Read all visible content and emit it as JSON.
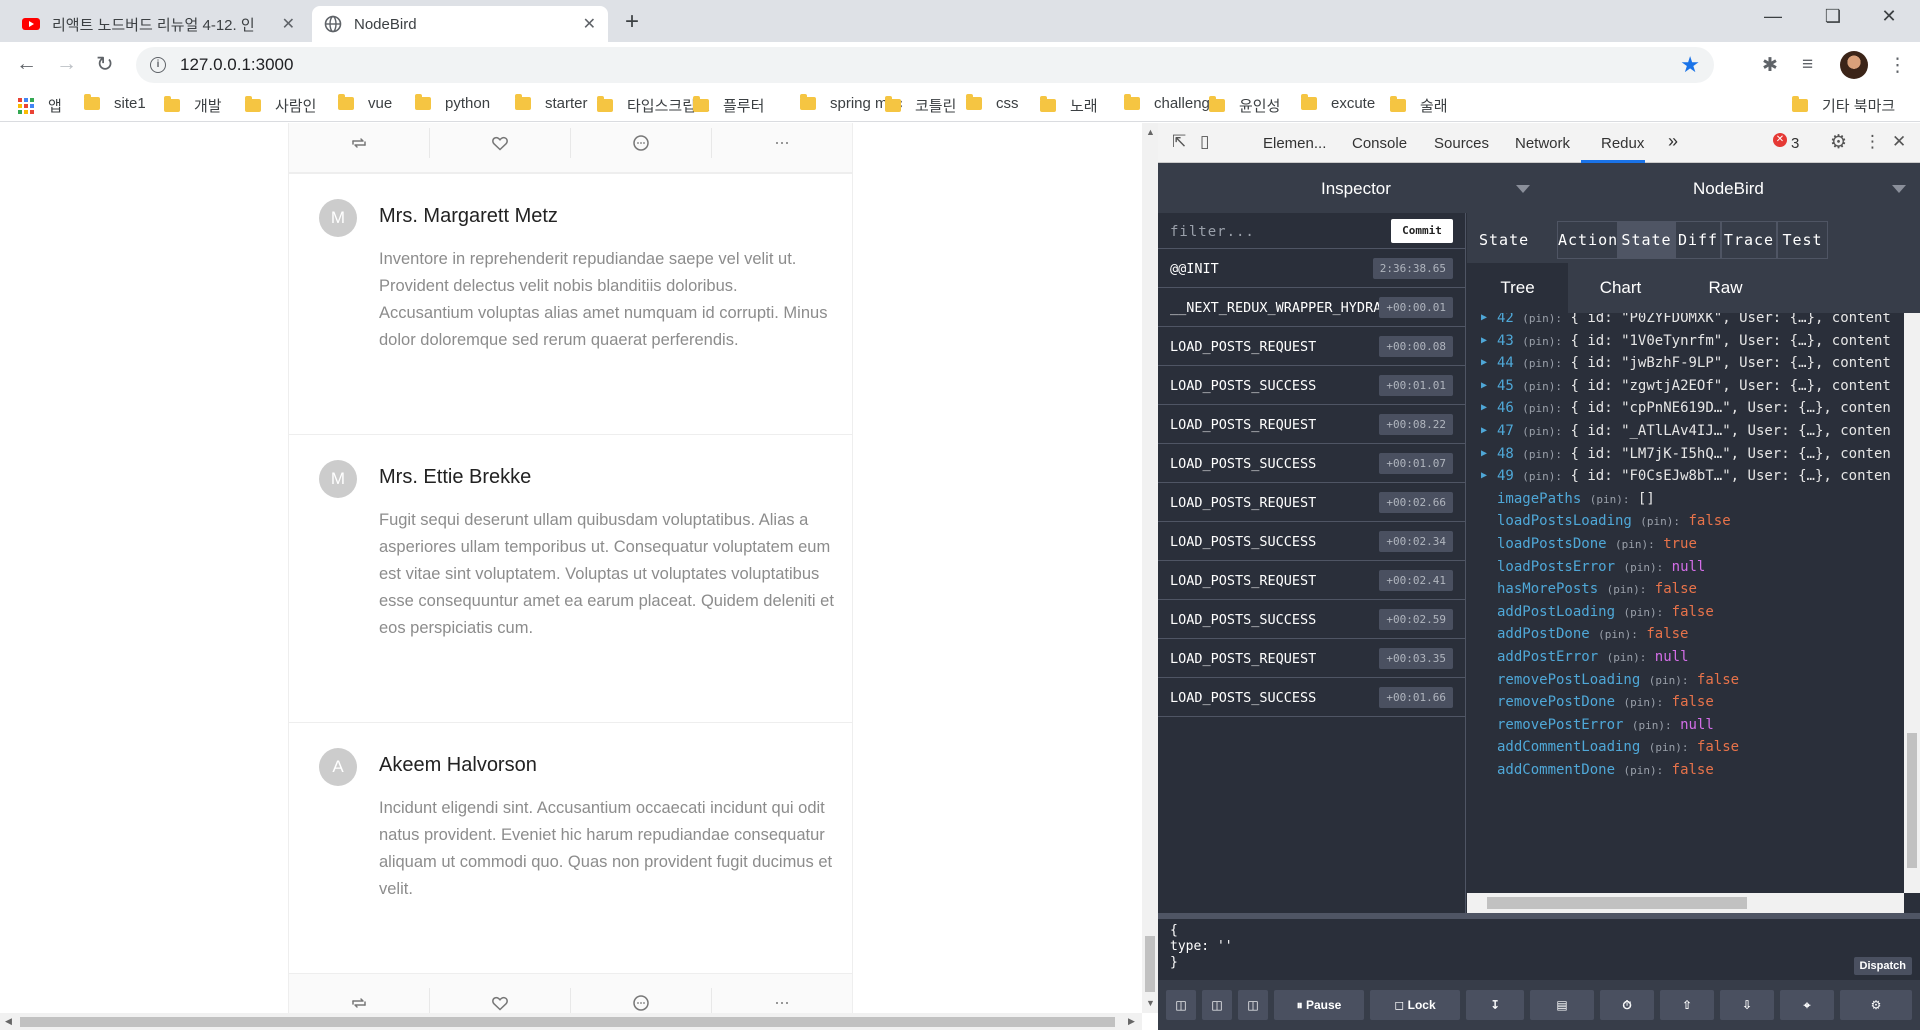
{
  "browser": {
    "tabs": [
      {
        "title": "리액트 노드버드 리뉴얼 4-12. 인",
        "close": "✕"
      },
      {
        "title": "NodeBird",
        "close": "✕"
      }
    ],
    "new_tab": "+",
    "url": "127.0.0.1:3000",
    "accent": "#1a73e8"
  },
  "bookmarks": {
    "apps": "앱",
    "items": [
      "site1",
      "개발",
      "사람인",
      "vue",
      "python",
      "starter",
      "타입스크립트",
      "플루터",
      "spring mvc",
      "코틀린",
      "css",
      "노래",
      "challenge",
      "윤인성",
      "excute",
      "술래"
    ],
    "other": "기타 북마크"
  },
  "feed": {
    "posts": [
      {
        "avatar": "M",
        "author": "Mrs. Margarett Metz",
        "content": "Inventore in reprehenderit repudiandae saepe vel velit ut. Provident delectus velit nobis blanditiis doloribus. Accusantium voluptas alias amet numquam id corrupti. Minus dolor doloremque sed rerum quaerat perferendis."
      },
      {
        "avatar": "M",
        "author": "Mrs. Ettie Brekke",
        "content": "Fugit sequi deserunt ullam quibusdam voluptatibus. Alias a asperiores ullam temporibus ut. Consequatur voluptatem eum est vitae sint voluptatem. Voluptas ut voluptates voluptatibus esse consequuntur amet ea earum placeat. Quidem deleniti et eos perspiciatis cum."
      },
      {
        "avatar": "A",
        "author": "Akeem Halvorson",
        "content": "Incidunt eligendi sint. Accusantium occaecati incidunt qui odit natus provident. Eveniet hic harum repudiandae consequatur aliquam ut commodi quo. Quas non provident fugit ducimus et velit."
      }
    ],
    "action_icons": [
      "retweet-icon",
      "heart-icon",
      "message-icon",
      "ellipsis-icon"
    ]
  },
  "devtools": {
    "tabs": [
      "Elemen...",
      "Console",
      "Sources",
      "Network",
      "Redux"
    ],
    "active_tab": "Redux",
    "more": "»",
    "error_count": "3",
    "error_color": "#e53935"
  },
  "redux": {
    "inspector_label": "Inspector",
    "instance_label": "NodeBird",
    "filter_placeholder": "filter...",
    "commit_label": "Commit",
    "actions": [
      {
        "name": "@@INIT",
        "time": "2:36:38.65"
      },
      {
        "name": "__NEXT_REDUX_WRAPPER_HYDRATE__",
        "time": "+00:00.01"
      },
      {
        "name": "LOAD_POSTS_REQUEST",
        "time": "+00:00.08"
      },
      {
        "name": "LOAD_POSTS_SUCCESS",
        "time": "+00:01.01"
      },
      {
        "name": "LOAD_POSTS_REQUEST",
        "time": "+00:08.22"
      },
      {
        "name": "LOAD_POSTS_SUCCESS",
        "time": "+00:01.07"
      },
      {
        "name": "LOAD_POSTS_REQUEST",
        "time": "+00:02.66"
      },
      {
        "name": "LOAD_POSTS_SUCCESS",
        "time": "+00:02.34"
      },
      {
        "name": "LOAD_POSTS_REQUEST",
        "time": "+00:02.41"
      },
      {
        "name": "LOAD_POSTS_SUCCESS",
        "time": "+00:02.59"
      },
      {
        "name": "LOAD_POSTS_REQUEST",
        "time": "+00:03.35"
      },
      {
        "name": "LOAD_POSTS_SUCCESS",
        "time": "+00:01.66"
      }
    ],
    "state_label": "State",
    "view_tabs": [
      "Action",
      "State",
      "Diff",
      "Trace",
      "Test"
    ],
    "active_view": "State",
    "sub_tabs": [
      "Tree",
      "Chart",
      "Raw"
    ],
    "active_sub": "Tree",
    "tree_rows": [
      {
        "idx": "42",
        "id": "\"P0ZYFDOMXK\"",
        "user": "User: {…}, content"
      },
      {
        "idx": "43",
        "id": "\"1V0eTynrfm\"",
        "user": "User: {…}, content"
      },
      {
        "idx": "44",
        "id": "\"jwBzhF-9LP\"",
        "user": "User: {…}, content"
      },
      {
        "idx": "45",
        "id": "\"zgwtjA2EOf\"",
        "user": "User: {…}, content"
      },
      {
        "idx": "46",
        "id": "\"cpPnNE619D…\"",
        "user": "User: {…}, conten"
      },
      {
        "idx": "47",
        "id": "\"_ATlLAv4IJ…\"",
        "user": "User: {…}, conten"
      },
      {
        "idx": "48",
        "id": "\"LM7jK-I5hQ…\"",
        "user": "User: {…}, conten"
      },
      {
        "idx": "49",
        "id": "\"F0CsEJw8bT…\"",
        "user": "User: {…}, conten"
      }
    ],
    "pin_label": "(pin):",
    "id_key": "{ id:",
    "state_keys": [
      {
        "key": "imagePaths",
        "value": "[]",
        "type": "arr"
      },
      {
        "key": "loadPostsLoading",
        "value": "false",
        "type": "bool"
      },
      {
        "key": "loadPostsDone",
        "value": "true",
        "type": "bool"
      },
      {
        "key": "loadPostsError",
        "value": "null",
        "type": "null"
      },
      {
        "key": "hasMorePosts",
        "value": "false",
        "type": "bool"
      },
      {
        "key": "addPostLoading",
        "value": "false",
        "type": "bool"
      },
      {
        "key": "addPostDone",
        "value": "false",
        "type": "bool"
      },
      {
        "key": "addPostError",
        "value": "null",
        "type": "null"
      },
      {
        "key": "removePostLoading",
        "value": "false",
        "type": "bool"
      },
      {
        "key": "removePostDone",
        "value": "false",
        "type": "bool"
      },
      {
        "key": "removePostError",
        "value": "null",
        "type": "null"
      },
      {
        "key": "addCommentLoading",
        "value": "false",
        "type": "bool"
      },
      {
        "key": "addCommentDone",
        "value": "false",
        "type": "bool"
      }
    ],
    "dispatch_text": "{\ntype: ''\n}",
    "dispatch_label": "Dispatch",
    "bottom": {
      "pause": "Pause",
      "lock": "Lock"
    }
  }
}
